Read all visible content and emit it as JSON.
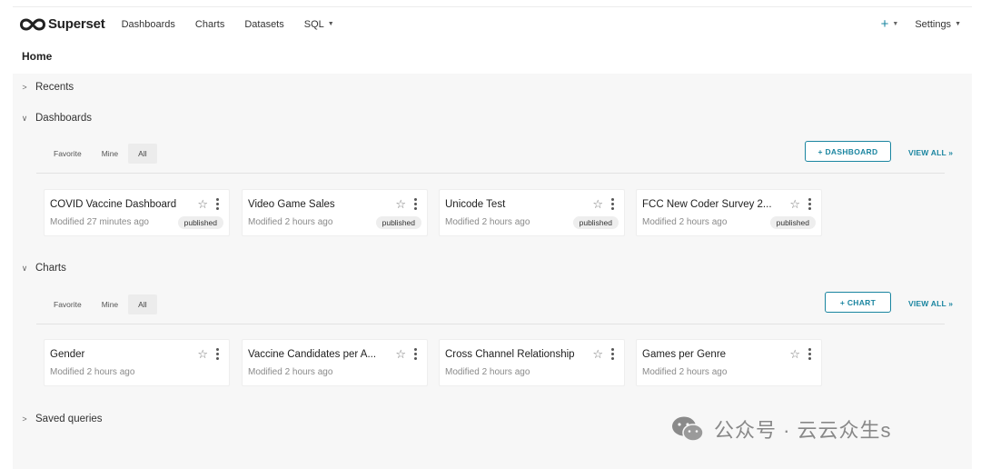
{
  "nav": {
    "brand": "Superset",
    "items": [
      {
        "label": "Dashboards",
        "has_caret": false
      },
      {
        "label": "Charts",
        "has_caret": false
      },
      {
        "label": "Datasets",
        "has_caret": false
      },
      {
        "label": "SQL",
        "has_caret": true
      }
    ],
    "plus": "+",
    "settings": "Settings"
  },
  "page_title": "Home",
  "sections": {
    "recents": {
      "label": "Recents",
      "expanded": false
    },
    "dashboards": {
      "label": "Dashboards",
      "expanded": true,
      "tabs": [
        "Favorite",
        "Mine",
        "All"
      ],
      "active_tab": "All",
      "add_button": "+ DASHBOARD",
      "view_all": "VIEW ALL »",
      "cards": [
        {
          "title": "COVID Vaccine Dashboard",
          "modified": "Modified 27 minutes ago",
          "badge": "published"
        },
        {
          "title": "Video Game Sales",
          "modified": "Modified 2 hours ago",
          "badge": "published"
        },
        {
          "title": "Unicode Test",
          "modified": "Modified 2 hours ago",
          "badge": "published"
        },
        {
          "title": "FCC New Coder Survey 2...",
          "modified": "Modified 2 hours ago",
          "badge": "published"
        }
      ]
    },
    "charts": {
      "label": "Charts",
      "expanded": true,
      "tabs": [
        "Favorite",
        "Mine",
        "All"
      ],
      "active_tab": "All",
      "add_button": "+ CHART",
      "view_all": "VIEW ALL »",
      "cards": [
        {
          "title": "Gender",
          "modified": "Modified 2 hours ago"
        },
        {
          "title": "Vaccine Candidates per A...",
          "modified": "Modified 2 hours ago"
        },
        {
          "title": "Cross Channel Relationship",
          "modified": "Modified 2 hours ago"
        },
        {
          "title": "Games per Genre",
          "modified": "Modified 2 hours ago"
        }
      ]
    },
    "saved_queries": {
      "label": "Saved queries",
      "expanded": false
    }
  },
  "watermark": "公众号 · 云云众生s",
  "colors": {
    "accent": "#1a85a0",
    "background": "#f7f7f7"
  }
}
